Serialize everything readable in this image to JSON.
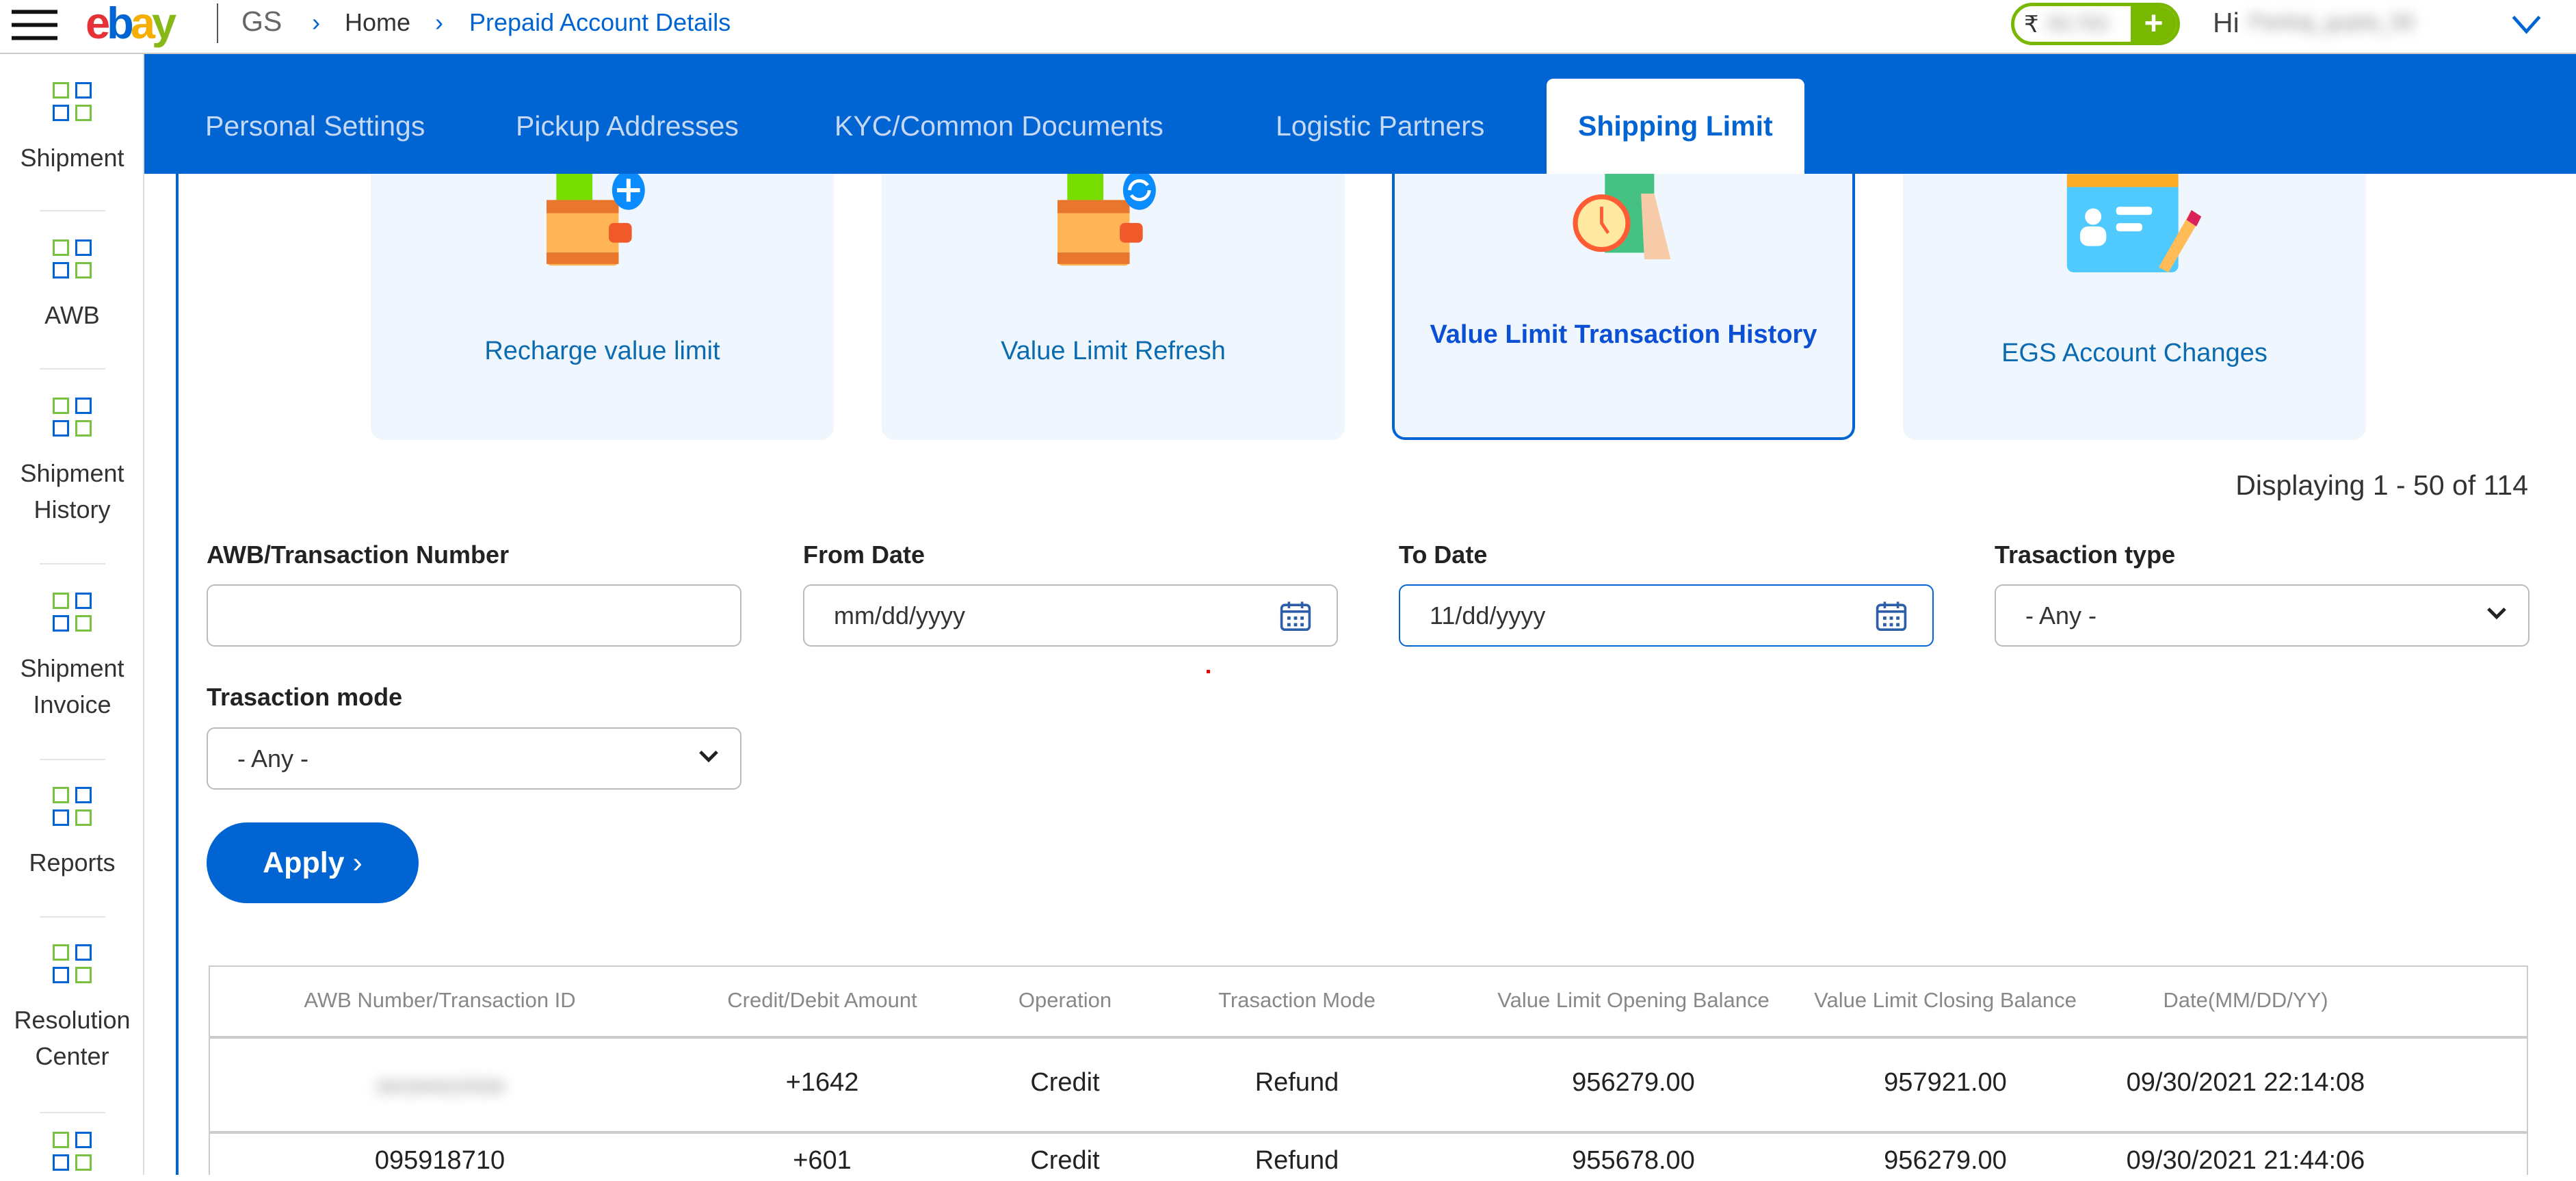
{
  "header": {
    "logo": "ebay",
    "brand": "GS",
    "breadcrumb": [
      "Home",
      "Prepaid Account Details"
    ],
    "wallet": {
      "currency_symbol": "₹",
      "balance": "00,763",
      "add_label": "+"
    },
    "greeting": "Hi",
    "user_name": "Pankaj_gupta_56"
  },
  "sidebar": {
    "items": [
      {
        "label": "Shipment",
        "icon": "grid-icon"
      },
      {
        "label": "AWB",
        "icon": "grid-icon"
      },
      {
        "label": "Shipment History",
        "icon": "grid-icon"
      },
      {
        "label": "Shipment Invoice",
        "icon": "grid-icon"
      },
      {
        "label": "Reports",
        "icon": "grid-icon"
      },
      {
        "label": "Resolution Center",
        "icon": "grid-icon"
      }
    ]
  },
  "tabs": [
    {
      "label": "Personal Settings",
      "active": false
    },
    {
      "label": "Pickup Addresses",
      "active": false
    },
    {
      "label": "KYC/Common Documents",
      "active": false
    },
    {
      "label": "Logistic Partners",
      "active": false
    },
    {
      "label": "Shipping Limit",
      "active": true
    }
  ],
  "cards": [
    {
      "label": "Recharge value limit",
      "icon": "wallet-add-icon"
    },
    {
      "label": "Value Limit Refresh",
      "icon": "wallet-refresh-icon"
    },
    {
      "label": "Value Limit Transaction History",
      "icon": "money-history-icon",
      "active": true
    },
    {
      "label": "EGS Account Changes",
      "icon": "profile-edit-icon"
    }
  ],
  "displaying": "Displaying 1 - 50 of 114",
  "filters": {
    "awb": {
      "label": "AWB/Transaction Number",
      "value": ""
    },
    "from": {
      "label": "From Date",
      "value": "mm/dd/yyyy"
    },
    "to": {
      "label": "To Date",
      "value": "11/dd/yyyy"
    },
    "type": {
      "label": "Trasaction type",
      "value": "- Any -"
    },
    "mode": {
      "label": "Trasaction mode",
      "value": "- Any -"
    }
  },
  "apply_label": "Apply",
  "table": {
    "headers": [
      "AWB Number/Transaction ID",
      "Credit/Debit Amount",
      "Operation",
      "Trasaction Mode",
      "Value Limit Opening Balance",
      "Value Limit Closing Balance",
      "Date(MM/DD/YY)"
    ],
    "rows": [
      [
        "2842849220558",
        "+1642",
        "Credit",
        "Refund",
        "956279.00",
        "957921.00",
        "09/30/2021 22:14:08"
      ],
      [
        "095918710",
        "+601",
        "Credit",
        "Refund",
        "955678.00",
        "956279.00",
        "09/30/2021 21:44:06"
      ]
    ]
  },
  "colors": {
    "primary": "#0064d2",
    "wallet_green": "#78b800",
    "card_bg": "#f0f6fd"
  }
}
